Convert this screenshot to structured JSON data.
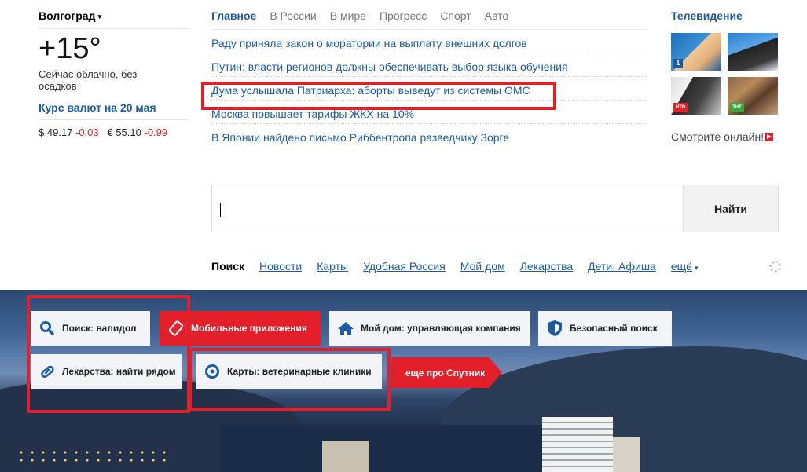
{
  "location": {
    "city": "Волгоград"
  },
  "weather": {
    "temperature": "+15°",
    "condition": "Сейчас облачно, без осадков"
  },
  "rates": {
    "title": "Курс валют на 20 мая",
    "usd_label": "$ 49.17",
    "usd_change": "-0.03",
    "eur_label": "€ 55.10",
    "eur_change": "-0.99"
  },
  "news": {
    "tabs": [
      "Главное",
      "В России",
      "В мире",
      "Прогресс",
      "Спорт",
      "Авто"
    ],
    "items": [
      "Раду приняла закон о моратории на выплату внешних долгов",
      "Путин: власти регионов должны обеспечивать выбор языка обучения",
      "Дума услышала Патриарха: аборты выведут из системы ОМС",
      "Москва повышает тарифы ЖКХ на 10%",
      "В Японии найдено письмо Риббентропа разведчику Зорге"
    ]
  },
  "tv": {
    "title": "Телевидение",
    "watch_label": "Смотрите онлайн!",
    "channel_badges": [
      "1",
      "",
      "НТВ",
      "ТНТ"
    ]
  },
  "search": {
    "button_label": "Найти",
    "value": ""
  },
  "services": {
    "first": "Поиск",
    "links": [
      "Новости",
      "Карты",
      "Удобная Россия",
      "Мой дом",
      "Лекарства",
      "Дети: Афиша"
    ],
    "more": "ещё"
  },
  "tiles": {
    "search_validol": "Поиск: валидол",
    "mobile_apps": "Мобильные приложения",
    "my_home": "Мой дом: управляющая компания",
    "safe_search": "Безопасный поиск",
    "medicines": "Лекарства: найти рядом",
    "maps_vet": "Карты: ветеринарные клиники",
    "more_sputnik": "еще про Спутник"
  },
  "colors": {
    "accent": "#e3202a",
    "link": "#1b5aa6"
  }
}
